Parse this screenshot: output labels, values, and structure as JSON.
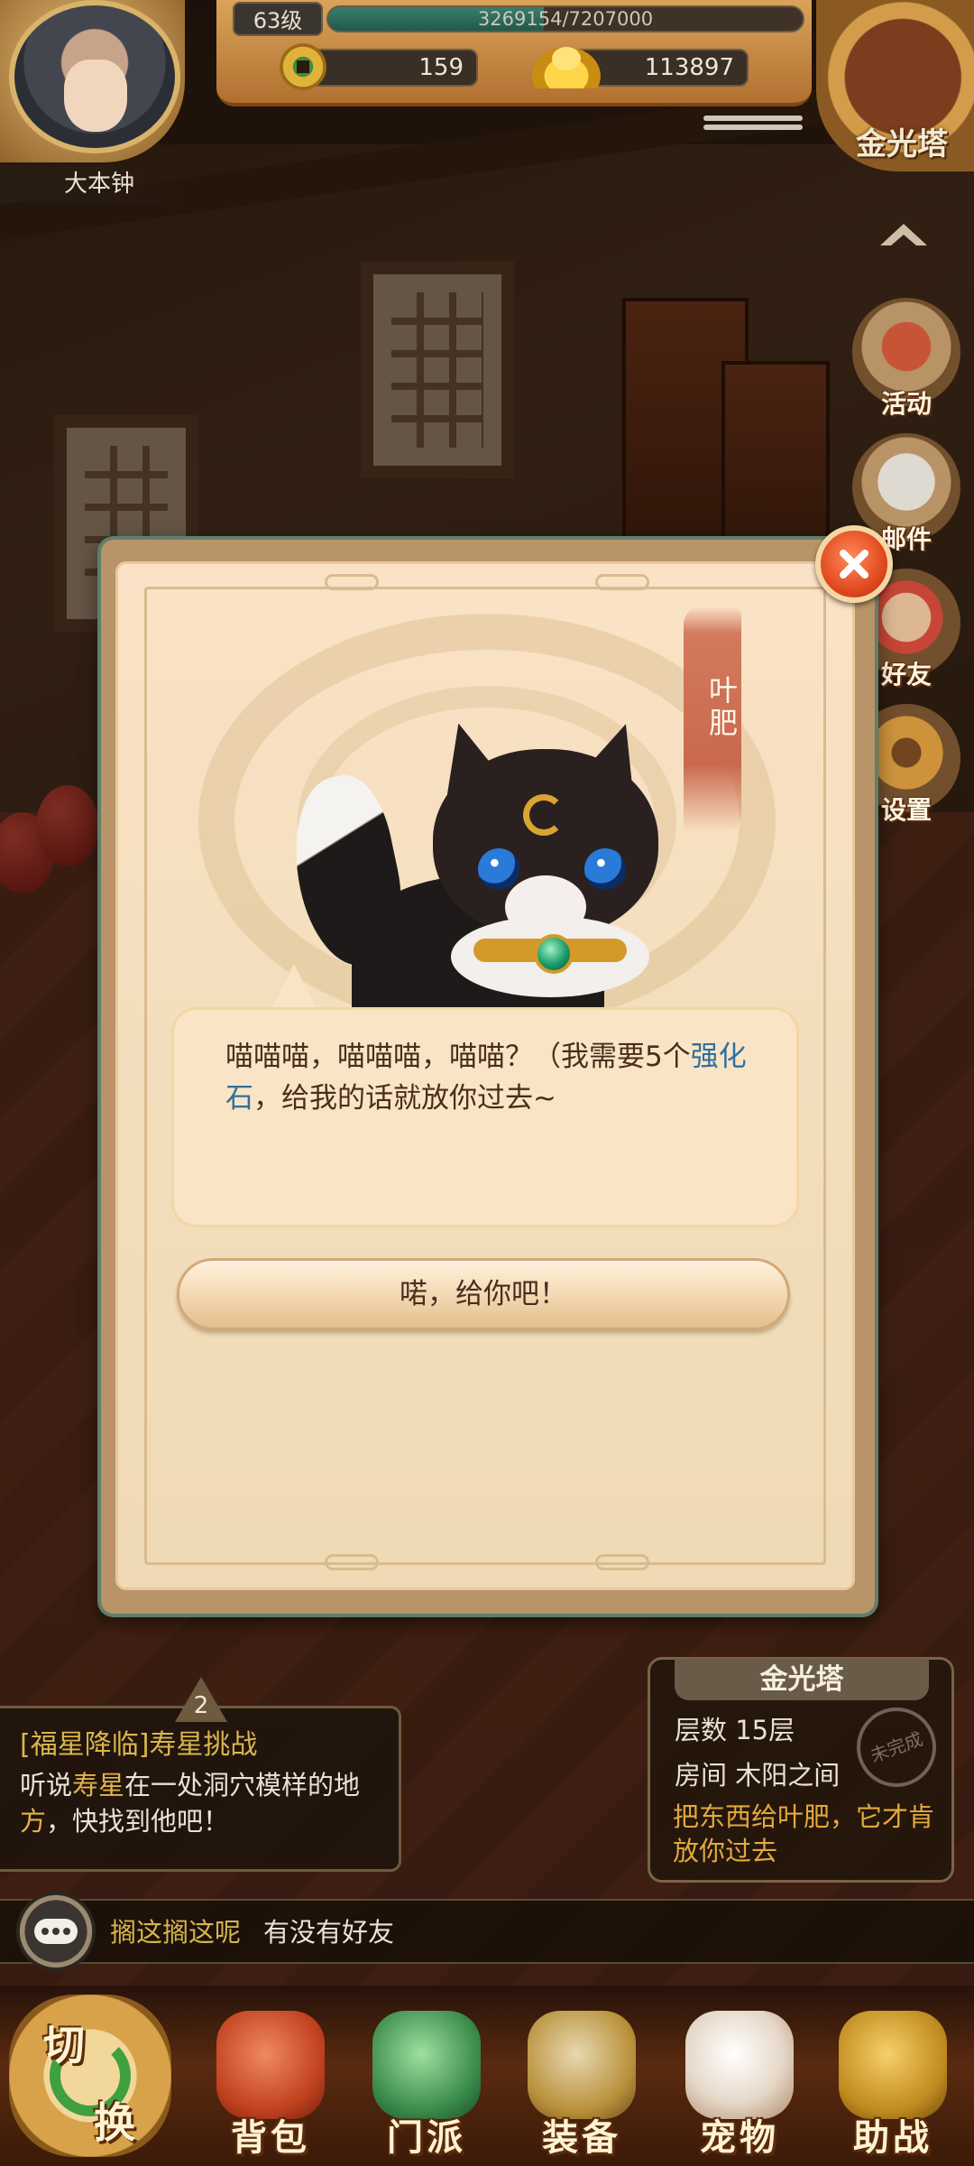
{
  "hud": {
    "player_name": "大本钟",
    "level": "63级",
    "exp_text": "3269154/7207000",
    "exp_progress": 0.4536,
    "copper": "159",
    "gold": "113897",
    "tower_name": "金光塔"
  },
  "side_menu": [
    {
      "label": "活动",
      "icon": "event-drum-icon"
    },
    {
      "label": "邮件",
      "icon": "mail-envelope-icon"
    },
    {
      "label": "好友",
      "icon": "friend-avatar-icon"
    },
    {
      "label": "设置",
      "icon": "gear-icon"
    }
  ],
  "dialog": {
    "npc_name": "叶肥",
    "message_before": "喵喵喵，喵喵喵，喵喵？（我需要5个",
    "message_highlight": "强化石",
    "message_after": "，给我的话就放你过去~",
    "confirm_label": "喏，给你吧！"
  },
  "quest": {
    "badge": "2",
    "title": "[福星降临]寿星挑战",
    "desc_1": "听说",
    "desc_highlight_1": "寿星",
    "desc_2": "在一处洞穴模样的地",
    "desc_3": "方",
    "desc_4": "，快找到他吧！"
  },
  "tower_info": {
    "title": "金光塔",
    "floor_label": "层数",
    "floor_value": "15层",
    "room_label": "房间",
    "room_value": "木阳之间",
    "stamp": "未完成",
    "hint": "把东西给叶肥，它才肯放你过去"
  },
  "chat": {
    "sender": "搁这搁这呢",
    "message": "有没有好友"
  },
  "bottom_nav": [
    {
      "label": "背包",
      "icon": "bag-icon"
    },
    {
      "label": "门派",
      "icon": "sect-lion-icon"
    },
    {
      "label": "装备",
      "icon": "equipment-sword-icon"
    },
    {
      "label": "宠物",
      "icon": "pet-cat-icon"
    },
    {
      "label": "助战",
      "icon": "assist-helmet-icon"
    }
  ],
  "switch_button": {
    "char_1": "切",
    "char_2": "换"
  },
  "colors": {
    "accent_red": "#e24a20",
    "highlight_blue": "#2f6f9f",
    "quest_gold": "#d8b64c",
    "hint_orange": "#e3a93c",
    "exp_fill": "#3c7d6d"
  }
}
